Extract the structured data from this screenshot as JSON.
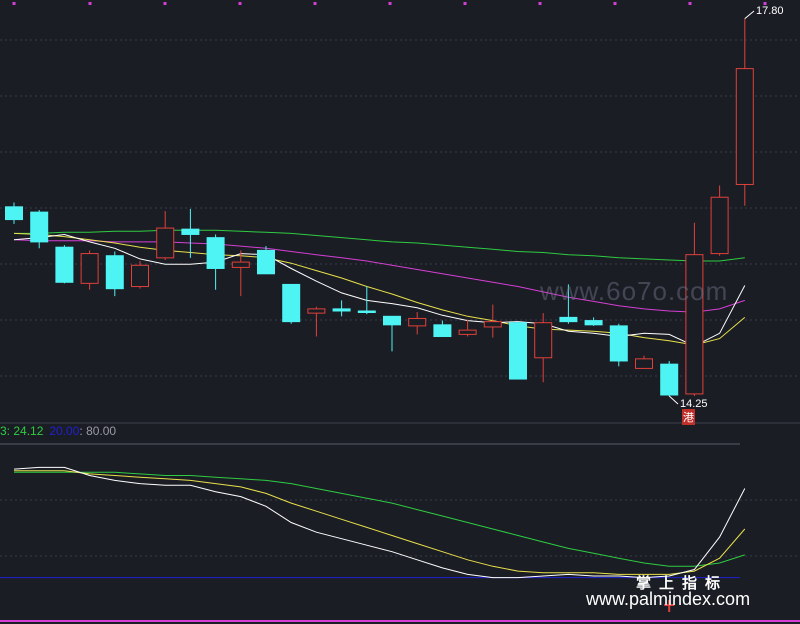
{
  "colors": {
    "background": "#1b1d25",
    "up": "#e0403a",
    "down": "#4ef3f3",
    "ma_white": "#ffffff",
    "ma_yellow": "#e8e04a",
    "ma_magenta": "#d53fd5",
    "ma_green": "#2ecc40",
    "level_blue": "#2020d0",
    "magenta_dot": "#d53fd5"
  },
  "labels": {
    "high_price": "17.80",
    "low_price": "14.25",
    "gang_tag": "港"
  },
  "indicator": {
    "v1": "3: 24.12",
    "v2": "20.00",
    "v3": ": 80.00"
  },
  "watermarks": {
    "middle": "www.6o7o.com",
    "chinese": "掌上指标",
    "url": "www.palmindex.com"
  },
  "chart_data": {
    "type": "candlestick",
    "ylim": [
      14.1,
      17.9
    ],
    "candles": [
      {
        "o": 16.03,
        "c": 15.91,
        "h": 16.07,
        "l": 15.87
      },
      {
        "o": 15.98,
        "c": 15.7,
        "h": 16.0,
        "l": 15.64
      },
      {
        "o": 15.65,
        "c": 15.32,
        "h": 15.67,
        "l": 15.31
      },
      {
        "o": 15.31,
        "c": 15.59,
        "h": 15.62,
        "l": 15.25
      },
      {
        "o": 15.57,
        "c": 15.26,
        "h": 15.61,
        "l": 15.19
      },
      {
        "o": 15.28,
        "c": 15.48,
        "h": 15.52,
        "l": 15.26
      },
      {
        "o": 15.55,
        "c": 15.83,
        "h": 15.99,
        "l": 15.53
      },
      {
        "o": 15.82,
        "c": 15.77,
        "h": 16.01,
        "l": 15.55
      },
      {
        "o": 15.74,
        "c": 15.45,
        "h": 15.77,
        "l": 15.25
      },
      {
        "o": 15.46,
        "c": 15.51,
        "h": 15.62,
        "l": 15.19
      },
      {
        "o": 15.62,
        "c": 15.4,
        "h": 15.66,
        "l": 15.4
      },
      {
        "o": 15.3,
        "c": 14.95,
        "h": 15.3,
        "l": 14.93
      },
      {
        "o": 15.03,
        "c": 15.07,
        "h": 15.09,
        "l": 14.81
      },
      {
        "o": 15.07,
        "c": 15.05,
        "h": 15.15,
        "l": 15.0
      },
      {
        "o": 15.05,
        "c": 15.04,
        "h": 15.28,
        "l": 15.02
      },
      {
        "o": 15.0,
        "c": 14.92,
        "h": 15.0,
        "l": 14.67
      },
      {
        "o": 14.91,
        "c": 14.98,
        "h": 15.04,
        "l": 14.83
      },
      {
        "o": 14.92,
        "c": 14.81,
        "h": 14.96,
        "l": 14.81
      },
      {
        "o": 14.83,
        "c": 14.87,
        "h": 14.97,
        "l": 14.81
      },
      {
        "o": 14.9,
        "c": 14.95,
        "h": 15.11,
        "l": 14.8
      },
      {
        "o": 14.94,
        "c": 14.41,
        "h": 14.94,
        "l": 14.41
      },
      {
        "o": 14.61,
        "c": 14.94,
        "h": 15.03,
        "l": 14.38
      },
      {
        "o": 14.99,
        "c": 14.95,
        "h": 15.3,
        "l": 14.93
      },
      {
        "o": 14.96,
        "c": 14.92,
        "h": 14.99,
        "l": 14.91
      },
      {
        "o": 14.91,
        "c": 14.58,
        "h": 14.93,
        "l": 14.53
      },
      {
        "o": 14.51,
        "c": 14.6,
        "h": 14.63,
        "l": 14.51
      },
      {
        "o": 14.55,
        "c": 14.26,
        "h": 14.58,
        "l": 14.25
      },
      {
        "o": 14.27,
        "c": 15.58,
        "h": 15.88,
        "l": 14.25
      },
      {
        "o": 15.59,
        "c": 16.12,
        "h": 16.23,
        "l": 15.57
      },
      {
        "o": 16.24,
        "c": 17.33,
        "h": 17.8,
        "l": 16.04
      }
    ],
    "ma_white": [
      15.72,
      15.74,
      15.77,
      15.7,
      15.64,
      15.54,
      15.49,
      15.49,
      15.51,
      15.59,
      15.58,
      15.45,
      15.33,
      15.22,
      15.15,
      15.12,
      15.08,
      15.01,
      14.96,
      14.94,
      14.95,
      14.93,
      14.86,
      14.84,
      14.81,
      14.84,
      14.83,
      14.72,
      14.84,
      15.29
    ],
    "ma_yellow": [
      15.78,
      15.77,
      15.75,
      15.72,
      15.69,
      15.65,
      15.62,
      15.6,
      15.58,
      15.57,
      15.55,
      15.5,
      15.43,
      15.36,
      15.28,
      15.21,
      15.13,
      15.06,
      15.0,
      14.96,
      14.91,
      14.88,
      14.87,
      14.86,
      14.84,
      14.8,
      14.77,
      14.73,
      14.79,
      14.99
    ],
    "ma_magenta": [
      15.72,
      15.71,
      15.71,
      15.71,
      15.7,
      15.7,
      15.7,
      15.69,
      15.68,
      15.66,
      15.64,
      15.61,
      15.58,
      15.55,
      15.52,
      15.48,
      15.44,
      15.4,
      15.36,
      15.32,
      15.28,
      15.23,
      15.18,
      15.14,
      15.1,
      15.07,
      15.05,
      15.04,
      15.07,
      15.15
    ],
    "ma_green": [
      15.78,
      15.78,
      15.79,
      15.79,
      15.8,
      15.8,
      15.81,
      15.81,
      15.81,
      15.8,
      15.79,
      15.78,
      15.76,
      15.74,
      15.72,
      15.7,
      15.69,
      15.67,
      15.65,
      15.63,
      15.61,
      15.6,
      15.58,
      15.57,
      15.55,
      15.54,
      15.53,
      15.52,
      15.52,
      15.55
    ],
    "indicator_ylim": [
      0,
      100
    ],
    "indicator_level": 20.0,
    "ind_white": [
      87,
      88,
      88,
      83,
      80,
      78,
      77,
      77,
      73,
      70,
      64,
      54,
      48,
      44,
      40,
      36,
      31,
      26,
      22,
      20,
      20,
      21,
      22,
      21,
      21,
      20,
      21,
      25,
      45,
      75
    ],
    "ind_yellow": [
      86,
      86,
      86,
      84,
      83,
      82,
      81,
      80,
      78,
      76,
      72,
      66,
      61,
      56,
      51,
      46,
      41,
      36,
      31,
      27,
      24,
      23,
      23,
      23,
      22,
      22,
      22,
      24,
      32,
      50
    ],
    "ind_green": [
      85,
      85,
      85,
      85,
      85,
      84,
      83,
      83,
      82,
      81,
      80,
      78,
      75,
      72,
      69,
      66,
      62,
      58,
      54,
      50,
      46,
      42,
      38,
      35,
      32,
      29,
      27,
      27,
      29,
      34
    ]
  }
}
